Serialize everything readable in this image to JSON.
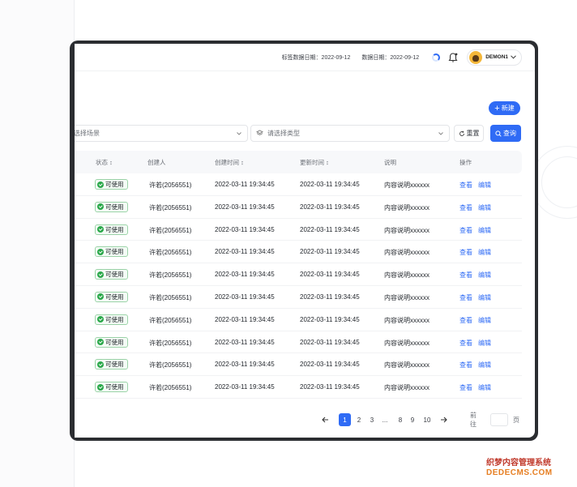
{
  "header": {
    "tag_date": "标签数据日期：2022-09-12",
    "data_date": "数据日期：2022-09-12",
    "user_name": "DEMON1"
  },
  "toolbar": {
    "new_label": "新建",
    "scene_placeholder": "选择场景",
    "type_placeholder": "请选择类型",
    "reset_label": "重置",
    "query_label": "查询"
  },
  "table": {
    "columns": [
      "状态",
      "创建人",
      "创建时间",
      "更新时间",
      "说明",
      "操作"
    ],
    "rows": [
      {
        "status": "可使用",
        "creator": "许若(2056551)",
        "created": "2022-03-11 19:34:45",
        "updated": "2022-03-11 19:34:45",
        "desc": "内容说明xxxxxx",
        "view": "查看",
        "edit": "编辑"
      },
      {
        "status": "可使用",
        "creator": "许若(2056551)",
        "created": "2022-03-11 19:34:45",
        "updated": "2022-03-11 19:34:45",
        "desc": "内容说明xxxxxx",
        "view": "查看",
        "edit": "编辑"
      },
      {
        "status": "可使用",
        "creator": "许若(2056551)",
        "created": "2022-03-11 19:34:45",
        "updated": "2022-03-11 19:34:45",
        "desc": "内容说明xxxxxx",
        "view": "查看",
        "edit": "编辑"
      },
      {
        "status": "可使用",
        "creator": "许若(2056551)",
        "created": "2022-03-11 19:34:45",
        "updated": "2022-03-11 19:34:45",
        "desc": "内容说明xxxxxx",
        "view": "查看",
        "edit": "编辑"
      },
      {
        "status": "可使用",
        "creator": "许若(2056551)",
        "created": "2022-03-11 19:34:45",
        "updated": "2022-03-11 19:34:45",
        "desc": "内容说明xxxxxx",
        "view": "查看",
        "edit": "编辑"
      },
      {
        "status": "可使用",
        "creator": "许若(2056551)",
        "created": "2022-03-11 19:34:45",
        "updated": "2022-03-11 19:34:45",
        "desc": "内容说明xxxxxx",
        "view": "查看",
        "edit": "编辑"
      },
      {
        "status": "可使用",
        "creator": "许若(2056551)",
        "created": "2022-03-11 19:34:45",
        "updated": "2022-03-11 19:34:45",
        "desc": "内容说明xxxxxx",
        "view": "查看",
        "edit": "编辑"
      },
      {
        "status": "可使用",
        "creator": "许若(2056551)",
        "created": "2022-03-11 19:34:45",
        "updated": "2022-03-11 19:34:45",
        "desc": "内容说明xxxxxx",
        "view": "查看",
        "edit": "编辑"
      },
      {
        "status": "可使用",
        "creator": "许若(2056551)",
        "created": "2022-03-11 19:34:45",
        "updated": "2022-03-11 19:34:45",
        "desc": "内容说明xxxxxx",
        "view": "查看",
        "edit": "编辑"
      },
      {
        "status": "可使用",
        "creator": "许若(2056551)",
        "created": "2022-03-11 19:34:45",
        "updated": "2022-03-11 19:34:45",
        "desc": "内容说明xxxxxx",
        "view": "查看",
        "edit": "编辑"
      }
    ]
  },
  "pagination": {
    "pages": [
      "1",
      "2",
      "3",
      "...",
      "8",
      "9",
      "10"
    ],
    "current_page": "1",
    "goto_label": "前往",
    "page_unit": "页"
  },
  "watermark": {
    "line1": "织梦内容管理系统",
    "line2": "DEDECMS.COM"
  },
  "colors": {
    "accent": "#2f6bf5",
    "success": "#2aa84a",
    "frame": "#2b2d31"
  }
}
